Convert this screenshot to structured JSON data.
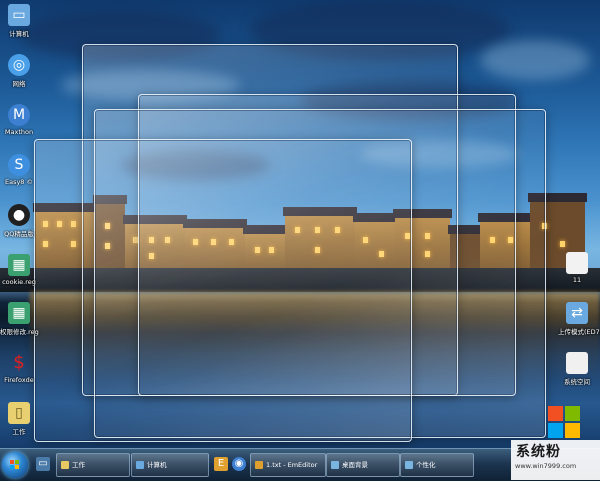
{
  "desktop_icons": [
    {
      "label": "计算机",
      "icon": "computer-icon",
      "color": "#6aa8e0"
    },
    {
      "label": "网络",
      "icon": "network-icon",
      "color": "#4aa0e8"
    },
    {
      "label": "Maxthon",
      "icon": "maxthon-browser-icon",
      "color": "#3d7fd0"
    },
    {
      "label": "Easy8 ©",
      "icon": "easy8-icon",
      "color": "#3f8fe0"
    },
    {
      "label": "QQ精品版",
      "icon": "qq-penguin-icon",
      "color": "#202020"
    },
    {
      "label": "cookie.reg",
      "icon": "registry-file-icon",
      "color": "#3aa070"
    },
    {
      "label": "权限修改.reg",
      "icon": "registry-file-icon",
      "color": "#3aa070"
    },
    {
      "label": "Firefoxde",
      "icon": "red-swirl-icon",
      "color": "#d02020"
    },
    {
      "label": "工作",
      "icon": "folder-icon",
      "color": "#e8d070"
    }
  ],
  "right_icons": [
    {
      "label": "11",
      "icon": "blank-document-icon"
    },
    {
      "label": "上传模式(ED7B447...",
      "icon": "network-share-icon"
    },
    {
      "label": "系统空间",
      "icon": "document-icon"
    }
  ],
  "taskbar": {
    "items": [
      {
        "label": "工作",
        "icon": "folder-icon",
        "color": "#e8c860"
      },
      {
        "label": "计算机",
        "icon": "computer-icon",
        "color": "#6aa8e0"
      },
      {
        "label": "1.txt - EmEditor",
        "icon": "emeditor-icon",
        "color": "#e0a030"
      },
      {
        "label": "桌面背景",
        "icon": "desktop-background-icon",
        "color": "#7ab4e0"
      },
      {
        "label": "个性化",
        "icon": "personalization-icon",
        "color": "#7ab4e0"
      }
    ]
  },
  "watermark": {
    "name": "系统粉",
    "url": "www.win7999.com",
    "colors": [
      "#f25022",
      "#7fba00",
      "#00a4ef",
      "#ffb900"
    ]
  }
}
